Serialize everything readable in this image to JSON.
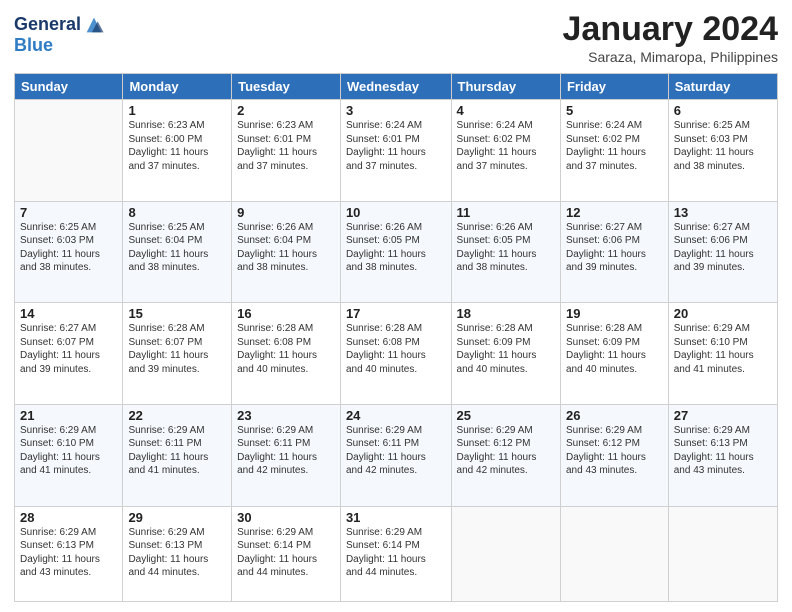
{
  "header": {
    "logo": {
      "line1": "General",
      "line2": "Blue"
    },
    "title": "January 2024",
    "subtitle": "Saraza, Mimaropa, Philippines"
  },
  "calendar": {
    "days_of_week": [
      "Sunday",
      "Monday",
      "Tuesday",
      "Wednesday",
      "Thursday",
      "Friday",
      "Saturday"
    ],
    "weeks": [
      [
        {
          "day": "",
          "info": ""
        },
        {
          "day": "1",
          "info": "Sunrise: 6:23 AM\nSunset: 6:00 PM\nDaylight: 11 hours\nand 37 minutes."
        },
        {
          "day": "2",
          "info": "Sunrise: 6:23 AM\nSunset: 6:01 PM\nDaylight: 11 hours\nand 37 minutes."
        },
        {
          "day": "3",
          "info": "Sunrise: 6:24 AM\nSunset: 6:01 PM\nDaylight: 11 hours\nand 37 minutes."
        },
        {
          "day": "4",
          "info": "Sunrise: 6:24 AM\nSunset: 6:02 PM\nDaylight: 11 hours\nand 37 minutes."
        },
        {
          "day": "5",
          "info": "Sunrise: 6:24 AM\nSunset: 6:02 PM\nDaylight: 11 hours\nand 37 minutes."
        },
        {
          "day": "6",
          "info": "Sunrise: 6:25 AM\nSunset: 6:03 PM\nDaylight: 11 hours\nand 38 minutes."
        }
      ],
      [
        {
          "day": "7",
          "info": "Sunrise: 6:25 AM\nSunset: 6:03 PM\nDaylight: 11 hours\nand 38 minutes."
        },
        {
          "day": "8",
          "info": "Sunrise: 6:25 AM\nSunset: 6:04 PM\nDaylight: 11 hours\nand 38 minutes."
        },
        {
          "day": "9",
          "info": "Sunrise: 6:26 AM\nSunset: 6:04 PM\nDaylight: 11 hours\nand 38 minutes."
        },
        {
          "day": "10",
          "info": "Sunrise: 6:26 AM\nSunset: 6:05 PM\nDaylight: 11 hours\nand 38 minutes."
        },
        {
          "day": "11",
          "info": "Sunrise: 6:26 AM\nSunset: 6:05 PM\nDaylight: 11 hours\nand 38 minutes."
        },
        {
          "day": "12",
          "info": "Sunrise: 6:27 AM\nSunset: 6:06 PM\nDaylight: 11 hours\nand 39 minutes."
        },
        {
          "day": "13",
          "info": "Sunrise: 6:27 AM\nSunset: 6:06 PM\nDaylight: 11 hours\nand 39 minutes."
        }
      ],
      [
        {
          "day": "14",
          "info": "Sunrise: 6:27 AM\nSunset: 6:07 PM\nDaylight: 11 hours\nand 39 minutes."
        },
        {
          "day": "15",
          "info": "Sunrise: 6:28 AM\nSunset: 6:07 PM\nDaylight: 11 hours\nand 39 minutes."
        },
        {
          "day": "16",
          "info": "Sunrise: 6:28 AM\nSunset: 6:08 PM\nDaylight: 11 hours\nand 40 minutes."
        },
        {
          "day": "17",
          "info": "Sunrise: 6:28 AM\nSunset: 6:08 PM\nDaylight: 11 hours\nand 40 minutes."
        },
        {
          "day": "18",
          "info": "Sunrise: 6:28 AM\nSunset: 6:09 PM\nDaylight: 11 hours\nand 40 minutes."
        },
        {
          "day": "19",
          "info": "Sunrise: 6:28 AM\nSunset: 6:09 PM\nDaylight: 11 hours\nand 40 minutes."
        },
        {
          "day": "20",
          "info": "Sunrise: 6:29 AM\nSunset: 6:10 PM\nDaylight: 11 hours\nand 41 minutes."
        }
      ],
      [
        {
          "day": "21",
          "info": "Sunrise: 6:29 AM\nSunset: 6:10 PM\nDaylight: 11 hours\nand 41 minutes."
        },
        {
          "day": "22",
          "info": "Sunrise: 6:29 AM\nSunset: 6:11 PM\nDaylight: 11 hours\nand 41 minutes."
        },
        {
          "day": "23",
          "info": "Sunrise: 6:29 AM\nSunset: 6:11 PM\nDaylight: 11 hours\nand 42 minutes."
        },
        {
          "day": "24",
          "info": "Sunrise: 6:29 AM\nSunset: 6:11 PM\nDaylight: 11 hours\nand 42 minutes."
        },
        {
          "day": "25",
          "info": "Sunrise: 6:29 AM\nSunset: 6:12 PM\nDaylight: 11 hours\nand 42 minutes."
        },
        {
          "day": "26",
          "info": "Sunrise: 6:29 AM\nSunset: 6:12 PM\nDaylight: 11 hours\nand 43 minutes."
        },
        {
          "day": "27",
          "info": "Sunrise: 6:29 AM\nSunset: 6:13 PM\nDaylight: 11 hours\nand 43 minutes."
        }
      ],
      [
        {
          "day": "28",
          "info": "Sunrise: 6:29 AM\nSunset: 6:13 PM\nDaylight: 11 hours\nand 43 minutes."
        },
        {
          "day": "29",
          "info": "Sunrise: 6:29 AM\nSunset: 6:13 PM\nDaylight: 11 hours\nand 44 minutes."
        },
        {
          "day": "30",
          "info": "Sunrise: 6:29 AM\nSunset: 6:14 PM\nDaylight: 11 hours\nand 44 minutes."
        },
        {
          "day": "31",
          "info": "Sunrise: 6:29 AM\nSunset: 6:14 PM\nDaylight: 11 hours\nand 44 minutes."
        },
        {
          "day": "",
          "info": ""
        },
        {
          "day": "",
          "info": ""
        },
        {
          "day": "",
          "info": ""
        }
      ]
    ]
  }
}
